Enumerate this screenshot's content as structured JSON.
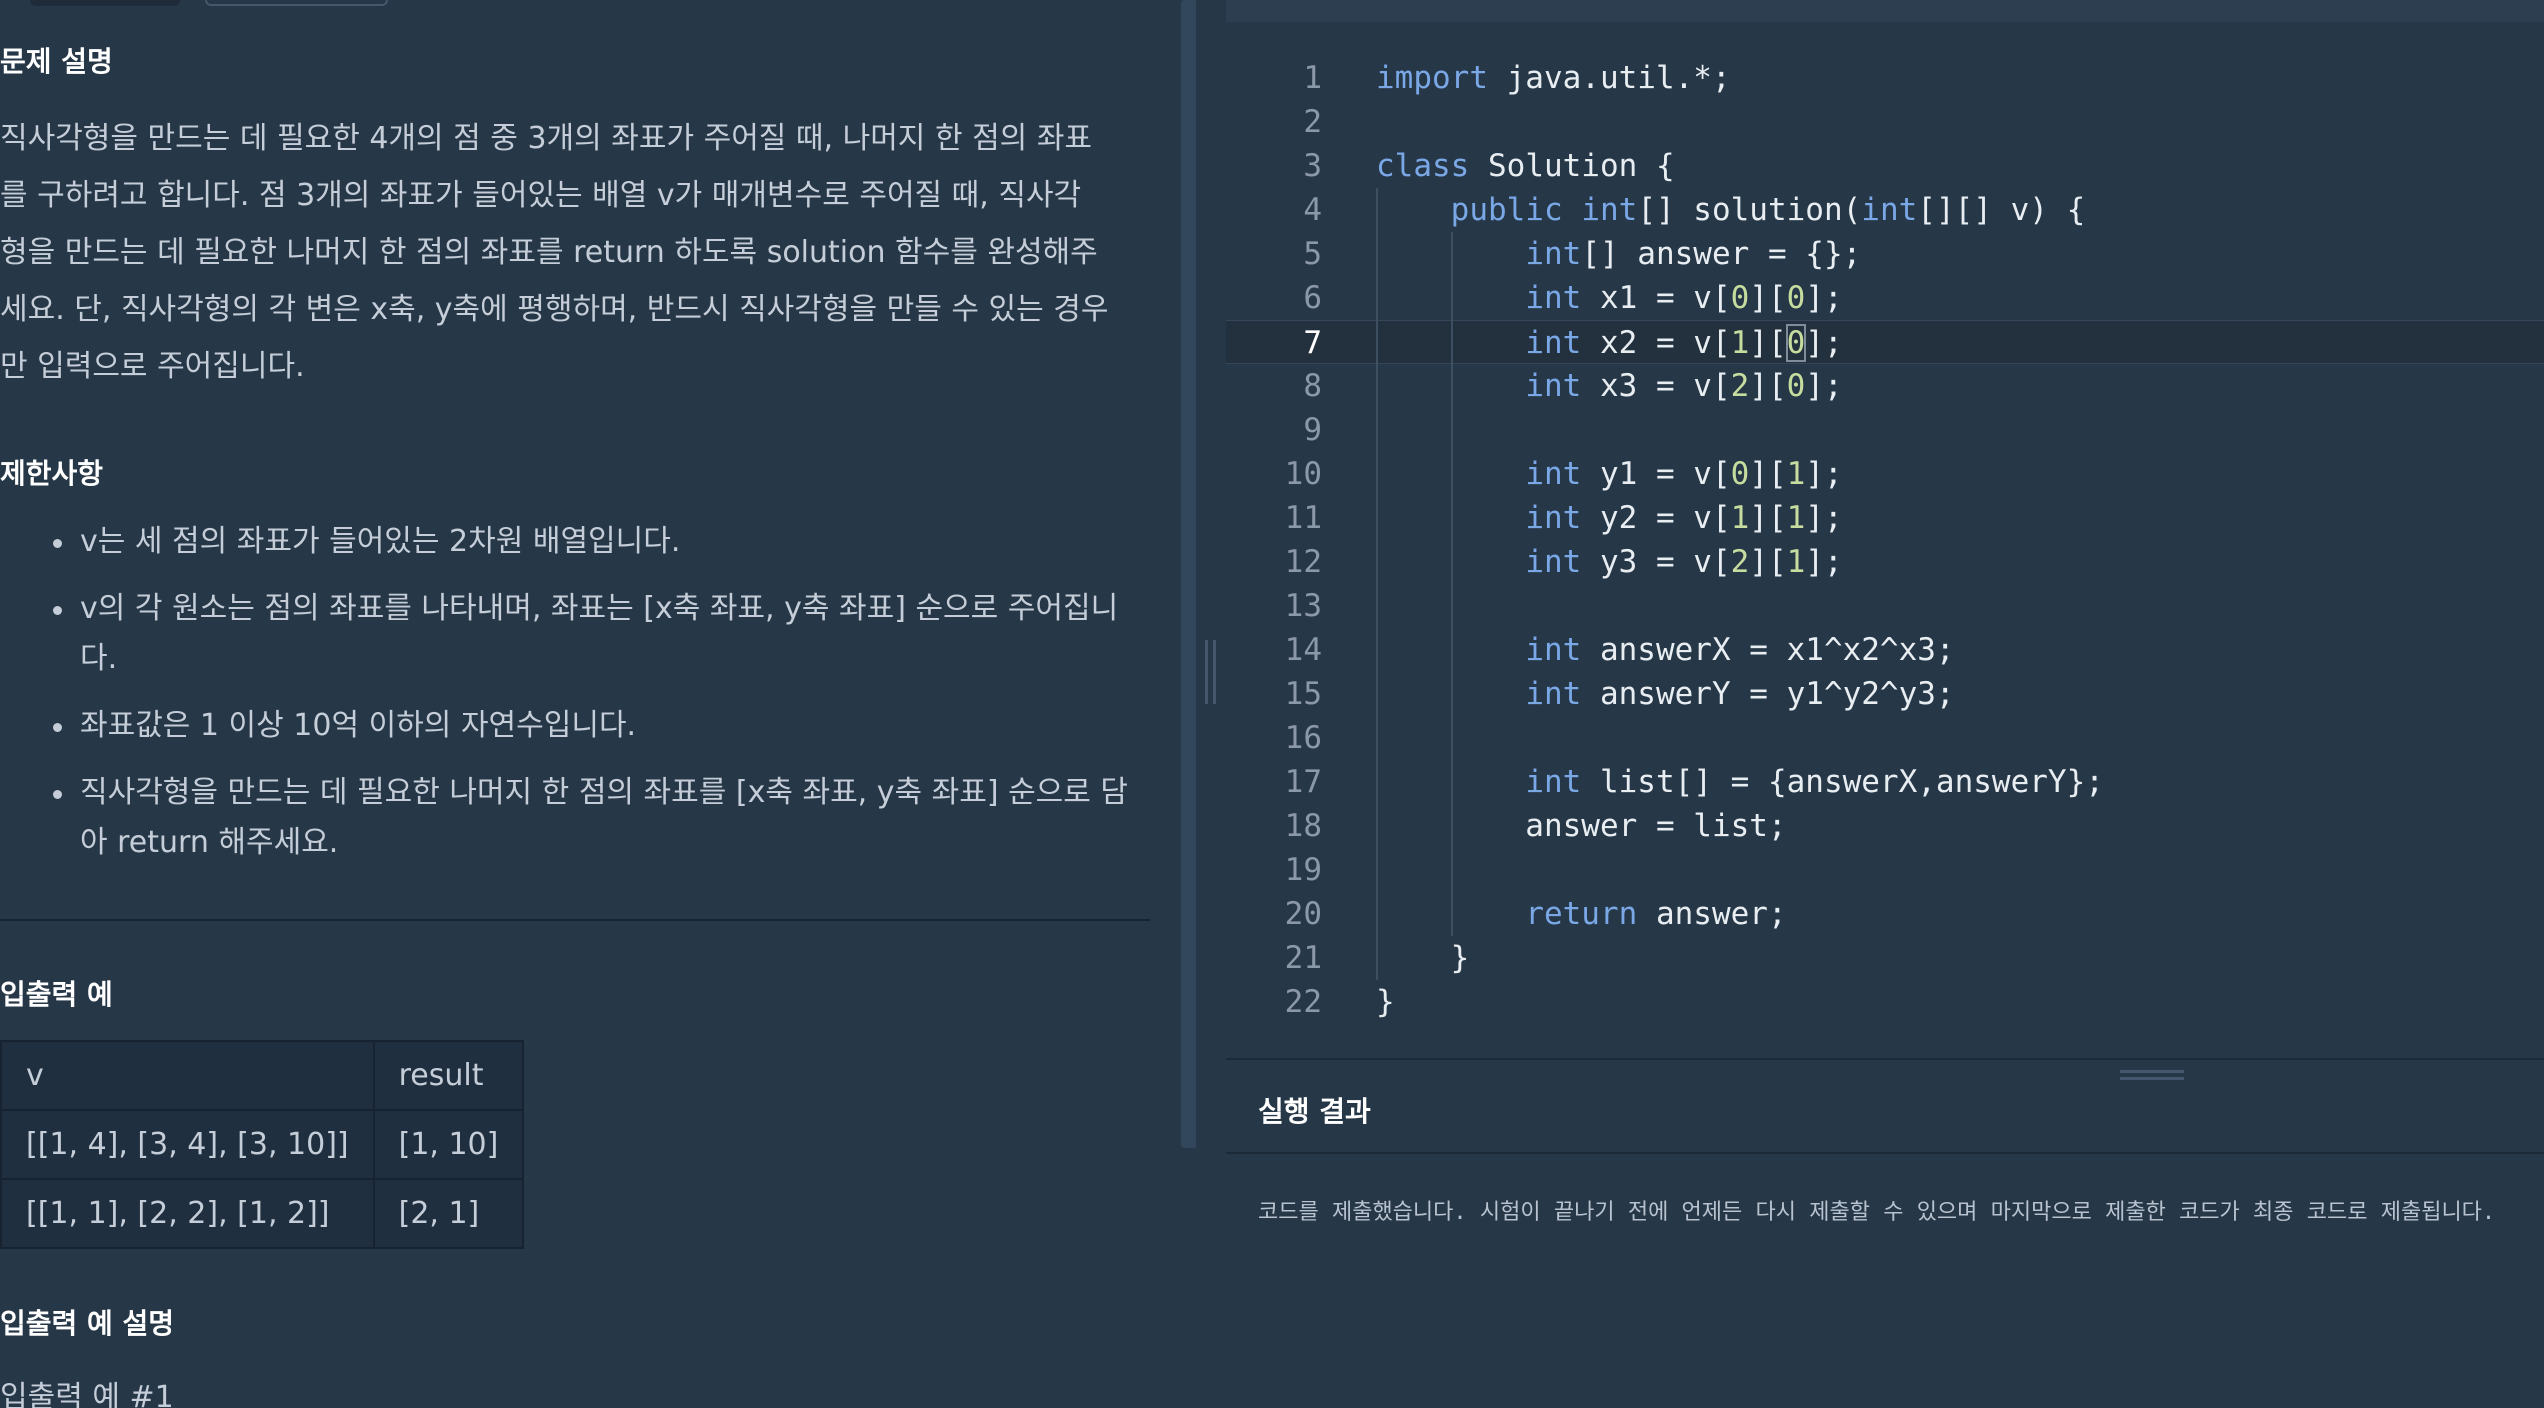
{
  "problem": {
    "description_title": "문제 설명",
    "description_lines": [
      "직사각형을 만드는 데 필요한 4개의 점 중 3개의 좌표가 주어질 때, 나머지 한 점의 좌표",
      "를 구하려고 합니다. 점 3개의 좌표가 들어있는 배열 v가 매개변수로 주어질 때, 직사각",
      "형을 만드는 데 필요한 나머지 한 점의 좌표를 return 하도록 solution 함수를 완성해주",
      "세요. 단, 직사각형의 각 변은 x축, y축에 평행하며, 반드시 직사각형을 만들 수 있는 경우",
      "만 입력으로 주어집니다."
    ],
    "constraints_title": "제한사항",
    "constraints": [
      "v는 세 점의 좌표가 들어있는 2차원 배열입니다.",
      "v의 각 원소는 점의 좌표를 나타내며, 좌표는 [x축 좌표, y축 좌표] 순으로 주어집니다.",
      "좌표값은 1 이상 10억 이하의 자연수입니다.",
      "직사각형을 만드는 데 필요한 나머지 한 점의 좌표를 [x축 좌표, y축 좌표] 순으로 담아 return 해주세요."
    ],
    "examples_title": "입출력 예",
    "examples_table": {
      "headers": [
        "v",
        "result"
      ],
      "rows": [
        [
          "[[1, 4], [3, 4], [3, 10]]",
          "[1, 10]"
        ],
        [
          "[[1, 1], [2, 2], [1, 2]]",
          "[2, 1]"
        ]
      ]
    },
    "explanation_title": "입출력 예 설명",
    "explanation_sub": "입출력 예 #1"
  },
  "editor": {
    "active_line": 7,
    "lines": [
      "import java.util.*;",
      "",
      "class Solution {",
      "    public int[] solution(int[][] v) {",
      "        int[] answer = {};",
      "        int x1 = v[0][0];",
      "        int x2 = v[1][0];",
      "        int x3 = v[2][0];",
      "",
      "        int y1 = v[0][1];",
      "        int y2 = v[1][1];",
      "        int y3 = v[2][1];",
      "",
      "        int answerX = x1^x2^x3;",
      "        int answerY = y1^y2^y3;",
      "",
      "        int list[] = {answerX,answerY};",
      "        answer = list;",
      "",
      "        return answer;",
      "    }",
      "}"
    ]
  },
  "result": {
    "title": "실행 결과",
    "message": "코드를 제출했습니다. 시험이 끝나기 전에 언제든 다시 제출할 수 있으며 마지막으로 제출한 코드가 최종 코드로 제출됩니다."
  }
}
